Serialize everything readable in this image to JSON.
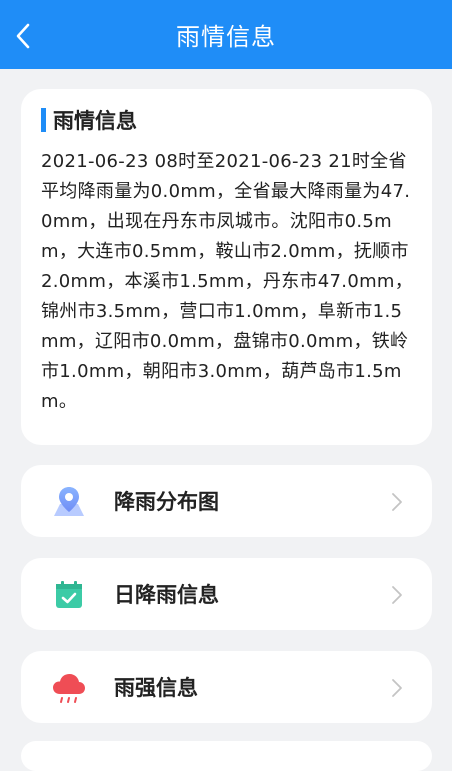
{
  "header": {
    "title": "雨情信息",
    "back_icon": "chevron-left-icon"
  },
  "summary": {
    "title": "雨情信息",
    "text": "2021-06-23 08时至2021-06-23 21时全省平均降雨量为0.0mm，全省最大降雨量为47.0mm，出现在丹东市凤城市。沈阳市0.5mm，大连市0.5mm，鞍山市2.0mm，抚顺市2.0mm，本溪市1.5mm，丹东市47.0mm，锦州市3.5mm，营口市1.0mm，阜新市1.5mm，辽阳市0.0mm，盘锦市0.0mm，铁岭市1.0mm，朝阳市3.0mm，葫芦岛市1.5mm。"
  },
  "menu": [
    {
      "label": "降雨分布图",
      "icon": "map-pin-icon"
    },
    {
      "label": "日降雨信息",
      "icon": "calendar-check-icon"
    },
    {
      "label": "雨强信息",
      "icon": "rain-cloud-icon"
    }
  ],
  "colors": {
    "primary": "#1f8df7",
    "background": "#f1f2f4"
  }
}
